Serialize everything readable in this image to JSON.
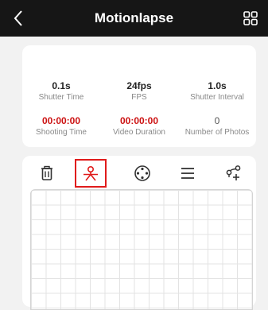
{
  "header": {
    "title": "Motionlapse"
  },
  "stats": {
    "shutter_time": {
      "value": "0.1s",
      "label": "Shutter Time"
    },
    "fps": {
      "value": "24fps",
      "label": "FPS"
    },
    "shutter_interval": {
      "value": "1.0s",
      "label": "Shutter Interval"
    },
    "shooting_time": {
      "value": "00:00:00",
      "label": "Shooting Time"
    },
    "video_duration": {
      "value": "00:00:00",
      "label": "Video Duration"
    },
    "number_of_photos": {
      "value": "0",
      "label": "Number of Photos"
    }
  },
  "toolbar": {
    "items": [
      "trash-icon",
      "position-pin-icon",
      "joystick-icon",
      "list-icon",
      "add-path-icon"
    ],
    "selected": "position-pin-icon"
  },
  "colors": {
    "accent_red": "#cc1111",
    "topbar": "#161616"
  }
}
